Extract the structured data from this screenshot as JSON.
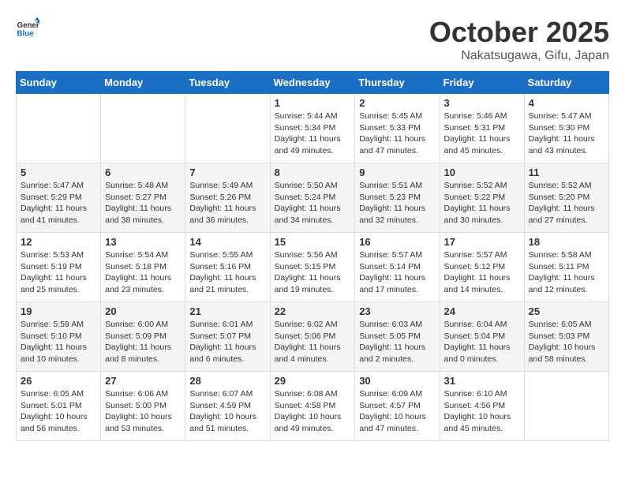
{
  "logo": {
    "general": "General",
    "blue": "Blue"
  },
  "header": {
    "month": "October 2025",
    "location": "Nakatsugawa, Gifu, Japan"
  },
  "weekdays": [
    "Sunday",
    "Monday",
    "Tuesday",
    "Wednesday",
    "Thursday",
    "Friday",
    "Saturday"
  ],
  "weeks": [
    [
      {
        "day": "",
        "info": ""
      },
      {
        "day": "",
        "info": ""
      },
      {
        "day": "",
        "info": ""
      },
      {
        "day": "1",
        "info": "Sunrise: 5:44 AM\nSunset: 5:34 PM\nDaylight: 11 hours and 49 minutes."
      },
      {
        "day": "2",
        "info": "Sunrise: 5:45 AM\nSunset: 5:33 PM\nDaylight: 11 hours and 47 minutes."
      },
      {
        "day": "3",
        "info": "Sunrise: 5:46 AM\nSunset: 5:31 PM\nDaylight: 11 hours and 45 minutes."
      },
      {
        "day": "4",
        "info": "Sunrise: 5:47 AM\nSunset: 5:30 PM\nDaylight: 11 hours and 43 minutes."
      }
    ],
    [
      {
        "day": "5",
        "info": "Sunrise: 5:47 AM\nSunset: 5:29 PM\nDaylight: 11 hours and 41 minutes."
      },
      {
        "day": "6",
        "info": "Sunrise: 5:48 AM\nSunset: 5:27 PM\nDaylight: 11 hours and 38 minutes."
      },
      {
        "day": "7",
        "info": "Sunrise: 5:49 AM\nSunset: 5:26 PM\nDaylight: 11 hours and 36 minutes."
      },
      {
        "day": "8",
        "info": "Sunrise: 5:50 AM\nSunset: 5:24 PM\nDaylight: 11 hours and 34 minutes."
      },
      {
        "day": "9",
        "info": "Sunrise: 5:51 AM\nSunset: 5:23 PM\nDaylight: 11 hours and 32 minutes."
      },
      {
        "day": "10",
        "info": "Sunrise: 5:52 AM\nSunset: 5:22 PM\nDaylight: 11 hours and 30 minutes."
      },
      {
        "day": "11",
        "info": "Sunrise: 5:52 AM\nSunset: 5:20 PM\nDaylight: 11 hours and 27 minutes."
      }
    ],
    [
      {
        "day": "12",
        "info": "Sunrise: 5:53 AM\nSunset: 5:19 PM\nDaylight: 11 hours and 25 minutes."
      },
      {
        "day": "13",
        "info": "Sunrise: 5:54 AM\nSunset: 5:18 PM\nDaylight: 11 hours and 23 minutes."
      },
      {
        "day": "14",
        "info": "Sunrise: 5:55 AM\nSunset: 5:16 PM\nDaylight: 11 hours and 21 minutes."
      },
      {
        "day": "15",
        "info": "Sunrise: 5:56 AM\nSunset: 5:15 PM\nDaylight: 11 hours and 19 minutes."
      },
      {
        "day": "16",
        "info": "Sunrise: 5:57 AM\nSunset: 5:14 PM\nDaylight: 11 hours and 17 minutes."
      },
      {
        "day": "17",
        "info": "Sunrise: 5:57 AM\nSunset: 5:12 PM\nDaylight: 11 hours and 14 minutes."
      },
      {
        "day": "18",
        "info": "Sunrise: 5:58 AM\nSunset: 5:11 PM\nDaylight: 11 hours and 12 minutes."
      }
    ],
    [
      {
        "day": "19",
        "info": "Sunrise: 5:59 AM\nSunset: 5:10 PM\nDaylight: 11 hours and 10 minutes."
      },
      {
        "day": "20",
        "info": "Sunrise: 6:00 AM\nSunset: 5:09 PM\nDaylight: 11 hours and 8 minutes."
      },
      {
        "day": "21",
        "info": "Sunrise: 6:01 AM\nSunset: 5:07 PM\nDaylight: 11 hours and 6 minutes."
      },
      {
        "day": "22",
        "info": "Sunrise: 6:02 AM\nSunset: 5:06 PM\nDaylight: 11 hours and 4 minutes."
      },
      {
        "day": "23",
        "info": "Sunrise: 6:03 AM\nSunset: 5:05 PM\nDaylight: 11 hours and 2 minutes."
      },
      {
        "day": "24",
        "info": "Sunrise: 6:04 AM\nSunset: 5:04 PM\nDaylight: 11 hours and 0 minutes."
      },
      {
        "day": "25",
        "info": "Sunrise: 6:05 AM\nSunset: 5:03 PM\nDaylight: 10 hours and 58 minutes."
      }
    ],
    [
      {
        "day": "26",
        "info": "Sunrise: 6:05 AM\nSunset: 5:01 PM\nDaylight: 10 hours and 56 minutes."
      },
      {
        "day": "27",
        "info": "Sunrise: 6:06 AM\nSunset: 5:00 PM\nDaylight: 10 hours and 53 minutes."
      },
      {
        "day": "28",
        "info": "Sunrise: 6:07 AM\nSunset: 4:59 PM\nDaylight: 10 hours and 51 minutes."
      },
      {
        "day": "29",
        "info": "Sunrise: 6:08 AM\nSunset: 4:58 PM\nDaylight: 10 hours and 49 minutes."
      },
      {
        "day": "30",
        "info": "Sunrise: 6:09 AM\nSunset: 4:57 PM\nDaylight: 10 hours and 47 minutes."
      },
      {
        "day": "31",
        "info": "Sunrise: 6:10 AM\nSunset: 4:56 PM\nDaylight: 10 hours and 45 minutes."
      },
      {
        "day": "",
        "info": ""
      }
    ]
  ]
}
